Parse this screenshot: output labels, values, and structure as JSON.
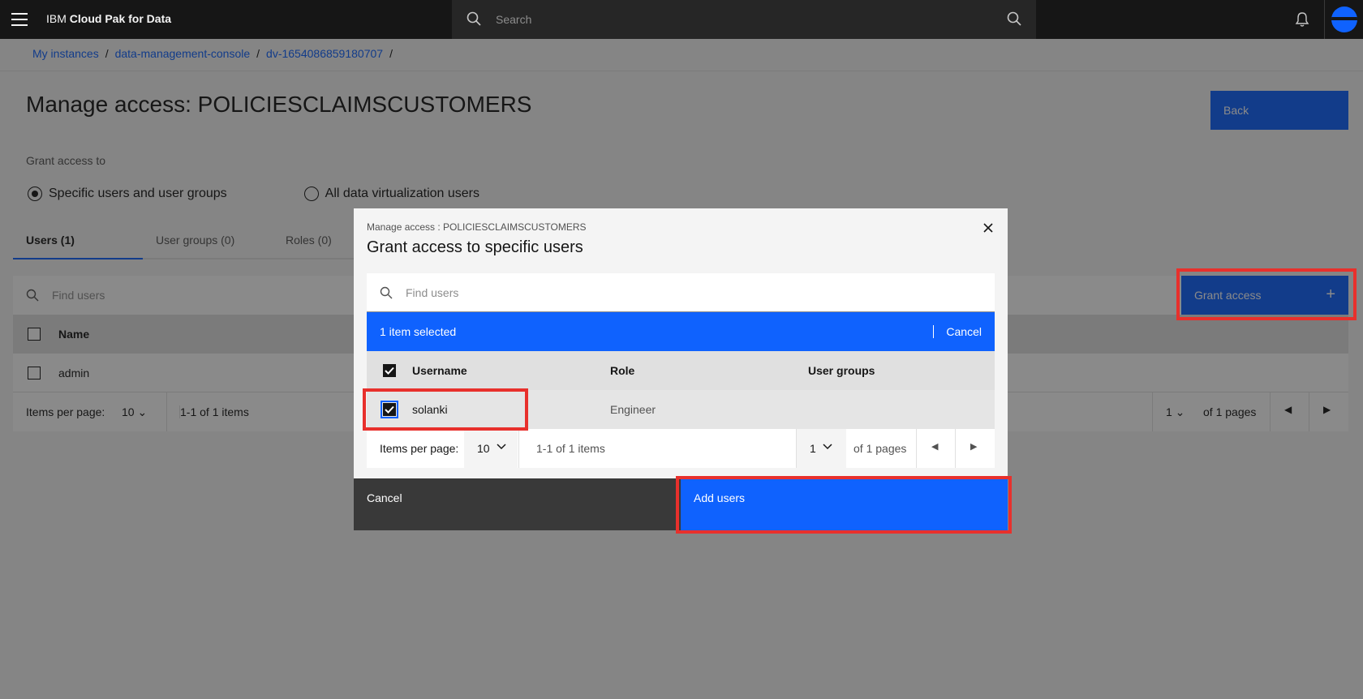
{
  "header": {
    "brand_prefix": "IBM ",
    "brand_name": "Cloud Pak for Data",
    "search_placeholder": "Search"
  },
  "breadcrumb": [
    "My instances",
    "data-management-console",
    "dv-1654086859180707"
  ],
  "page": {
    "title": "Manage access: POLICIESCLAIMSCUSTOMERS",
    "back_label": "Back",
    "grant_access_to_label": "Grant access to",
    "radio_specific": "Specific users and user groups",
    "radio_all": "All data virtualization users",
    "tabs": [
      {
        "label": "Users (1)"
      },
      {
        "label": "User groups (0)"
      },
      {
        "label": "Roles (0)"
      }
    ],
    "find_users_placeholder": "Find users",
    "grant_access_button": "Grant access",
    "table": {
      "column_name": "Name",
      "rows": [
        {
          "name": "admin"
        }
      ]
    },
    "pagination": {
      "items_per_page_label": "Items per page:",
      "items_per_page": "10",
      "range": "1-1 of 1 items",
      "page": "1",
      "of_pages": "of 1 pages"
    }
  },
  "modal": {
    "label": "Manage access : POLICIESCLAIMSCUSTOMERS",
    "title": "Grant access to specific users",
    "search_placeholder": "Find users",
    "batch_selected": "1 item selected",
    "batch_cancel": "Cancel",
    "columns": {
      "username": "Username",
      "role": "Role",
      "user_groups": "User groups"
    },
    "rows": [
      {
        "username": "solanki",
        "role": "Engineer",
        "user_groups": "",
        "selected": true
      }
    ],
    "pagination": {
      "items_per_page_label": "Items per page:",
      "items_per_page": "10",
      "range": "1-1 of 1 items",
      "page": "1",
      "of_pages": "of 1 pages"
    },
    "cancel_label": "Cancel",
    "add_users_label": "Add users"
  },
  "colors": {
    "primary": "#0f62fe",
    "header_bg": "#161616",
    "highlight": "#e8302c"
  }
}
